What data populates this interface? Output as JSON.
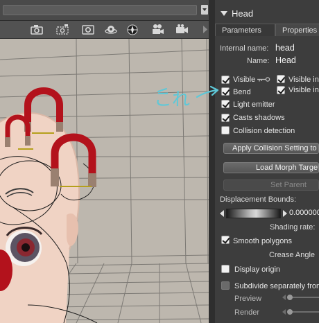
{
  "panel": {
    "title": "Head",
    "tabs": [
      {
        "label": "Parameters",
        "selected": false
      },
      {
        "label": "Properties",
        "selected": true
      }
    ],
    "internal_name_label": "Internal name:",
    "internal_name_value": "head",
    "name_label": "Name:",
    "name_value": "Head",
    "checkboxes": {
      "visible": {
        "label": "Visible",
        "checked": true
      },
      "visible_in": {
        "label": "Visible in",
        "checked": true
      },
      "bend": {
        "label": "Bend",
        "checked": true
      },
      "visible_in_2": {
        "label": "Visible in",
        "checked": true
      },
      "light_emitter": {
        "label": "Light emitter",
        "checked": true
      },
      "casts_shadows": {
        "label": "Casts shadows",
        "checked": true
      },
      "collision_detection": {
        "label": "Collision detection",
        "checked": false
      },
      "smooth_polygons": {
        "label": "Smooth polygons",
        "checked": true
      },
      "display_origin": {
        "label": "Display origin",
        "checked": false
      },
      "subdivide": {
        "label": "Subdivide separately from",
        "checked": false
      }
    },
    "buttons": {
      "apply_collision": "Apply Collision Setting to C",
      "load_morph": "Load Morph Target",
      "set_parent": "Set Parent"
    },
    "displacement_label": "Displacement Bounds:",
    "displacement_value": "0.000000",
    "shading_rate_label": "Shading rate:",
    "crease_angle_label": "Crease Angle",
    "preview_label": "Preview",
    "render_label": "Render"
  },
  "annotation": {
    "text": "これ"
  },
  "colors": {
    "viewport_bg": "#bdb7ae",
    "panel_bg": "#3d3d3d",
    "magnet_red": "#b3121c",
    "annotation": "#5ec8d8"
  },
  "icons": [
    "camera-icon",
    "camera-dashed-icon",
    "camera-frame-icon",
    "orbit-camera-icon",
    "sphere-camera-icon",
    "movie-camera-icon",
    "video-camera-icon",
    "chevron-right-icon",
    "key-icon",
    "collapse-triangle-icon"
  ]
}
